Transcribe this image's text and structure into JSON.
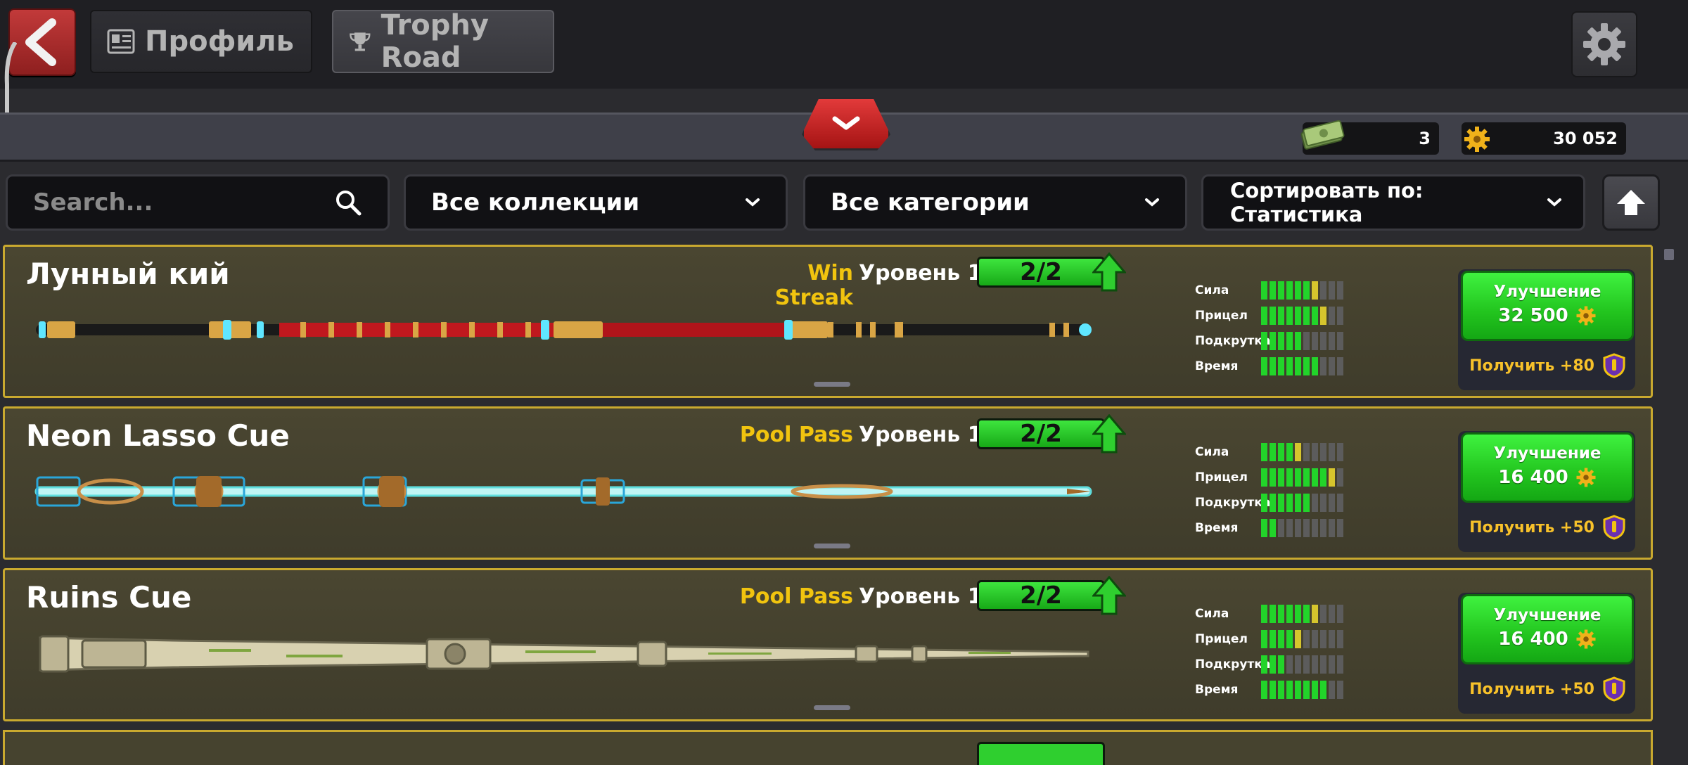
{
  "header": {
    "tabs": [
      {
        "label": "Профиль",
        "icon": "profile-card-icon"
      },
      {
        "label": "Trophy Road",
        "icon": "trophy-icon"
      }
    ]
  },
  "currencies": [
    {
      "name": "cash",
      "icon": "cash-icon",
      "value": "3"
    },
    {
      "name": "coins",
      "icon": "coin-gear-icon",
      "value": "30 052"
    }
  ],
  "filters": {
    "search_placeholder": "Search...",
    "collection": "Все коллекции",
    "category": "Все категории",
    "sort": "Сортировать по: Статистика"
  },
  "stat_labels": [
    "Сила",
    "Прицел",
    "Подкрутка",
    "Время"
  ],
  "cues": [
    {
      "name": "Лунный кий",
      "source": "Win Streak",
      "level": "Уровень 1",
      "progress": "2/2",
      "stats": [
        6,
        7,
        5,
        7
      ],
      "stat_half": [
        true,
        true,
        false,
        false
      ],
      "upgrade_label": "Улучшение",
      "upgrade_cost": "32 500",
      "reward": "Получить +80"
    },
    {
      "name": "Neon Lasso Cue",
      "source": "Pool Pass",
      "level": "Уровень 1",
      "progress": "2/2",
      "stats": [
        4,
        8,
        6,
        2
      ],
      "stat_half": [
        true,
        true,
        false,
        false
      ],
      "upgrade_label": "Улучшение",
      "upgrade_cost": "16 400",
      "reward": "Получить +50"
    },
    {
      "name": "Ruins Cue",
      "source": "Pool Pass",
      "level": "Уровень 1",
      "progress": "2/2",
      "stats": [
        6,
        4,
        3,
        8
      ],
      "stat_half": [
        true,
        true,
        false,
        false
      ],
      "upgrade_label": "Улучшение",
      "upgrade_cost": "16 400",
      "reward": "Получить +50"
    }
  ],
  "colors": {
    "accent_green": "#22c41e",
    "card_border": "#c9a92f",
    "source_yellow": "#f1c40f",
    "back_red": "#c23a3a"
  }
}
